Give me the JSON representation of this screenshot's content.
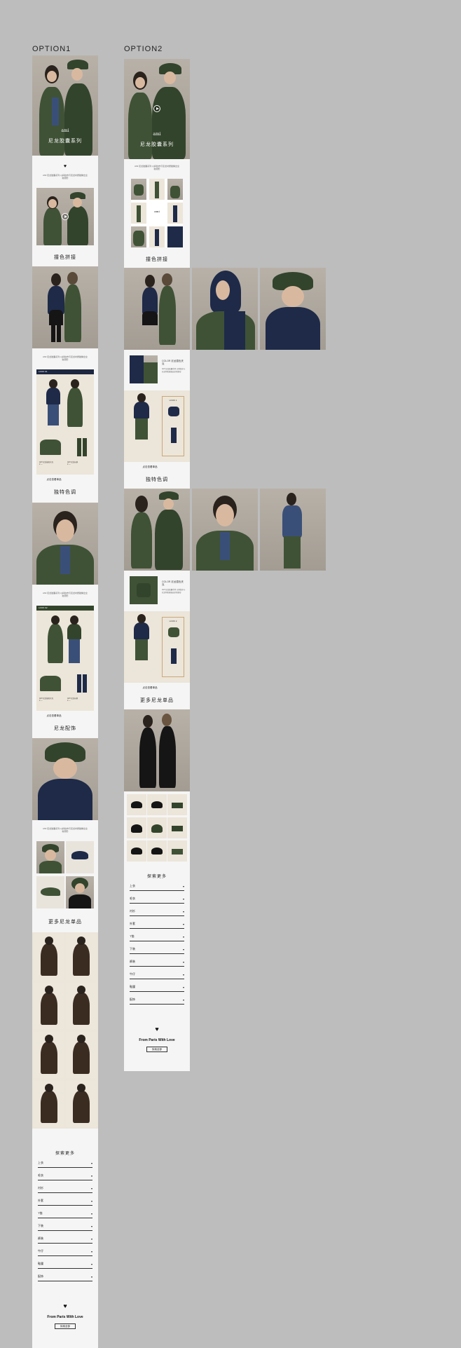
{
  "labels": {
    "option1": "OPTION1",
    "option2": "OPTION2"
  },
  "brand": {
    "logo": "ami",
    "tagline": "From Paris With Love",
    "cta": "探索全部"
  },
  "option1": {
    "hero_caption": "尼龙胶囊系列",
    "intro_text": "AMI 尼龙胶囊系列 以斜纹布与尼龙材质碰撞出全新廓形",
    "sections": [
      {
        "caption": "撞色拼接"
      },
      {
        "caption": "独特色调",
        "look_label": "LOOK 01",
        "tag": "点击查看单品"
      },
      {
        "caption": "尼龙配饰",
        "look_label": "LOOK 02",
        "tag": "点击查看单品"
      },
      {
        "caption": "更多尼龙单品"
      }
    ],
    "explore_title": "探索更多",
    "menu": [
      "上衣",
      "毛衣",
      "衬衫",
      "外套",
      "T恤",
      "下装",
      "裤装",
      "牛仔",
      "鞋履",
      "配饰"
    ]
  },
  "option2": {
    "hero_caption": "尼龙胶囊系列",
    "intro_text": "AMI 尼龙胶囊系列 以斜纹布与尼龙材质碰撞出全新廓形",
    "sections": [
      {
        "caption": "撞色拼接"
      },
      {
        "caption": "独特色调",
        "look_label": "LOOK 1",
        "color_label": "COLOR 尼龙撞色夹克",
        "tag": "点击查看单品"
      },
      {
        "caption": "更多尼龙单品",
        "look_label": "LOOK 2",
        "color_label": "COLOR 尼龙撞色夹克",
        "tag": "点击查看单品"
      }
    ],
    "explore_title": "探索更多",
    "menu": [
      "上衣",
      "毛衣",
      "衬衫",
      "外套",
      "T恤",
      "下装",
      "裤装",
      "牛仔",
      "鞋履",
      "配饰"
    ]
  }
}
